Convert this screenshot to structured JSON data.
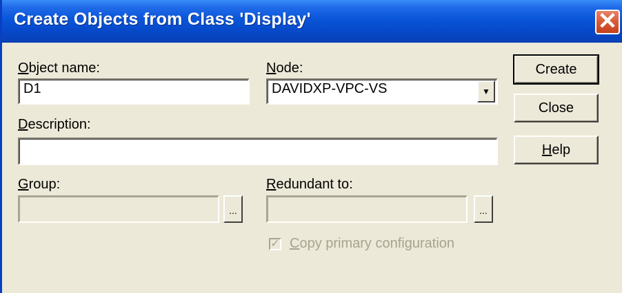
{
  "window": {
    "title": "Create Objects from Class 'Display'",
    "close_glyph": "✕"
  },
  "fields": {
    "object_name": {
      "label": "Object name:",
      "value": "D1"
    },
    "node": {
      "label": "Node:",
      "value": "DAVIDXP-VPC-VS"
    },
    "description": {
      "label": "Description:",
      "value": ""
    },
    "group": {
      "label": "Group:",
      "value": "",
      "browse_label": "..."
    },
    "redundant_to": {
      "label": "Redundant to:",
      "value": "",
      "browse_label": "..."
    },
    "copy_primary": {
      "label": "Copy primary configuration",
      "checked": true,
      "check_glyph": "✓"
    }
  },
  "buttons": {
    "create": "Create",
    "close": "Close",
    "help": "Help"
  },
  "icons": {
    "dropdown": "chevron-down-icon",
    "close": "close-icon"
  }
}
